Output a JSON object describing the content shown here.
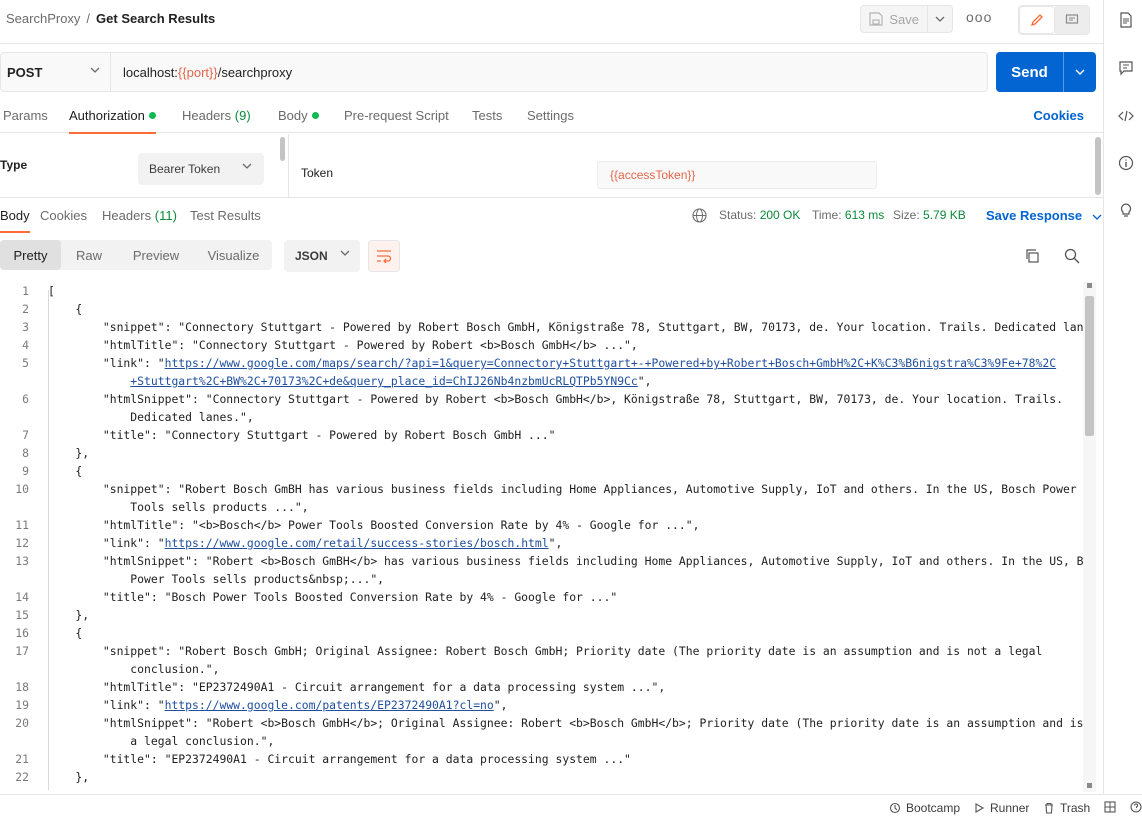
{
  "header": {
    "collection": "SearchProxy",
    "separator": "/",
    "request_name": "Get Search Results",
    "save_label": "Save",
    "more_label": "ooo"
  },
  "request": {
    "method": "POST",
    "url_prefix": "localhost:",
    "url_var": "{{port}}",
    "url_suffix": "/searchproxy",
    "send_label": "Send"
  },
  "request_tabs": {
    "params": "Params",
    "authorization": "Authorization",
    "headers": "Headers",
    "headers_count": "(9)",
    "body": "Body",
    "prerequest": "Pre-request Script",
    "tests": "Tests",
    "settings": "Settings",
    "cookies": "Cookies"
  },
  "auth": {
    "type_label": "Type",
    "type_value": "Bearer Token",
    "token_label": "Token",
    "token_value": "{{accessToken}}"
  },
  "response_tabs": {
    "body": "Body",
    "cookies": "Cookies",
    "headers": "Headers",
    "headers_count": "(11)",
    "test_results": "Test Results",
    "status_label": "Status:",
    "status_value": "200 OK",
    "time_label": "Time:",
    "time_value": "613 ms",
    "size_label": "Size:",
    "size_value": "5.79 KB",
    "save_response": "Save Response"
  },
  "view": {
    "pretty": "Pretty",
    "raw": "Raw",
    "preview": "Preview",
    "visualize": "Visualize",
    "format": "JSON"
  },
  "code_lines": [
    {
      "n": "1",
      "t": "["
    },
    {
      "n": "2",
      "t": "    {"
    },
    {
      "n": "3",
      "t": "        \"snippet\": \"Connectory Stuttgart - Powered by Robert Bosch GmbH, Königstraße 78, Stuttgart, BW, 70173, de. Your location. Trails. Dedicated lanes.\","
    },
    {
      "n": "4",
      "t": "        \"htmlTitle\": \"Connectory Stuttgart - Powered by Robert <b>Bosch GmbH</b> ...\","
    },
    {
      "n": "5",
      "t": "        \"link\": \"",
      "link": "https://www.google.com/maps/search/?api=1&query=Connectory+Stuttgart+-+Powered+by+Robert+Bosch+GmbH%2C+K%C3%B6nigstra%C3%9Fe+78%2C",
      "after": ""
    },
    {
      "n": "",
      "t": "            ",
      "link": "+Stuttgart%2C+BW%2C+70173%2C+de&query_place_id=ChIJ26Nb4nzbmUcRLQTPb5YN9Cc",
      "after": "\","
    },
    {
      "n": "6",
      "t": "        \"htmlSnippet\": \"Connectory Stuttgart - Powered by Robert <b>Bosch GmbH</b>, Königstraße 78, Stuttgart, BW, 70173, de. Your location. Trails."
    },
    {
      "n": "",
      "t": "            Dedicated lanes.\","
    },
    {
      "n": "7",
      "t": "        \"title\": \"Connectory Stuttgart - Powered by Robert Bosch GmbH ...\""
    },
    {
      "n": "8",
      "t": "    },"
    },
    {
      "n": "9",
      "t": "    {"
    },
    {
      "n": "10",
      "t": "        \"snippet\": \"Robert Bosch GmBH has various business fields including Home Appliances, Automotive Supply, IoT and others. In the US, Bosch Power"
    },
    {
      "n": "",
      "t": "            Tools sells products ...\","
    },
    {
      "n": "11",
      "t": "        \"htmlTitle\": \"<b>Bosch</b> Power Tools Boosted Conversion Rate by 4% - Google for ...\","
    },
    {
      "n": "12",
      "t": "        \"link\": \"",
      "link": "https://www.google.com/retail/success-stories/bosch.html",
      "after": "\","
    },
    {
      "n": "13",
      "t": "        \"htmlSnippet\": \"Robert <b>Bosch GmBH</b> has various business fields including Home Appliances, Automotive Supply, IoT and others. In the US, Bosch"
    },
    {
      "n": "",
      "t": "            Power Tools sells products&nbsp;...\","
    },
    {
      "n": "14",
      "t": "        \"title\": \"Bosch Power Tools Boosted Conversion Rate by 4% - Google for ...\""
    },
    {
      "n": "15",
      "t": "    },"
    },
    {
      "n": "16",
      "t": "    {"
    },
    {
      "n": "17",
      "t": "        \"snippet\": \"Robert Bosch GmbH; Original Assignee: Robert Bosch GmbH; Priority date (The priority date is an assumption and is not a legal"
    },
    {
      "n": "",
      "t": "            conclusion.\","
    },
    {
      "n": "18",
      "t": "        \"htmlTitle\": \"EP2372490A1 - Circuit arrangement for a data processing system ...\","
    },
    {
      "n": "19",
      "t": "        \"link\": \"",
      "link": "https://www.google.com/patents/EP2372490A1?cl=no",
      "after": "\","
    },
    {
      "n": "20",
      "t": "        \"htmlSnippet\": \"Robert <b>Bosch GmbH</b>; Original Assignee: Robert <b>Bosch GmbH</b>; Priority date (The priority date is an assumption and is not"
    },
    {
      "n": "",
      "t": "            a legal conclusion.\","
    },
    {
      "n": "21",
      "t": "        \"title\": \"EP2372490A1 - Circuit arrangement for a data processing system ...\""
    },
    {
      "n": "22",
      "t": "    },"
    }
  ],
  "statusbar": {
    "bootcamp": "Bootcamp",
    "runner": "Runner",
    "trash": "Trash"
  },
  "colors": {
    "accent": "#ff6c37",
    "primary": "#0265d2",
    "success": "#0cbb52",
    "variable": "#e2664b"
  },
  "icons": [
    "save-icon",
    "pencil-icon",
    "comment-icon",
    "document-icon",
    "code-icon",
    "info-icon",
    "lightbulb-icon",
    "globe-icon",
    "wrap-lines-icon",
    "copy-icon",
    "search-icon",
    "bootcamp-icon",
    "runner-icon",
    "trash-icon",
    "layout-icon",
    "help-icon"
  ]
}
